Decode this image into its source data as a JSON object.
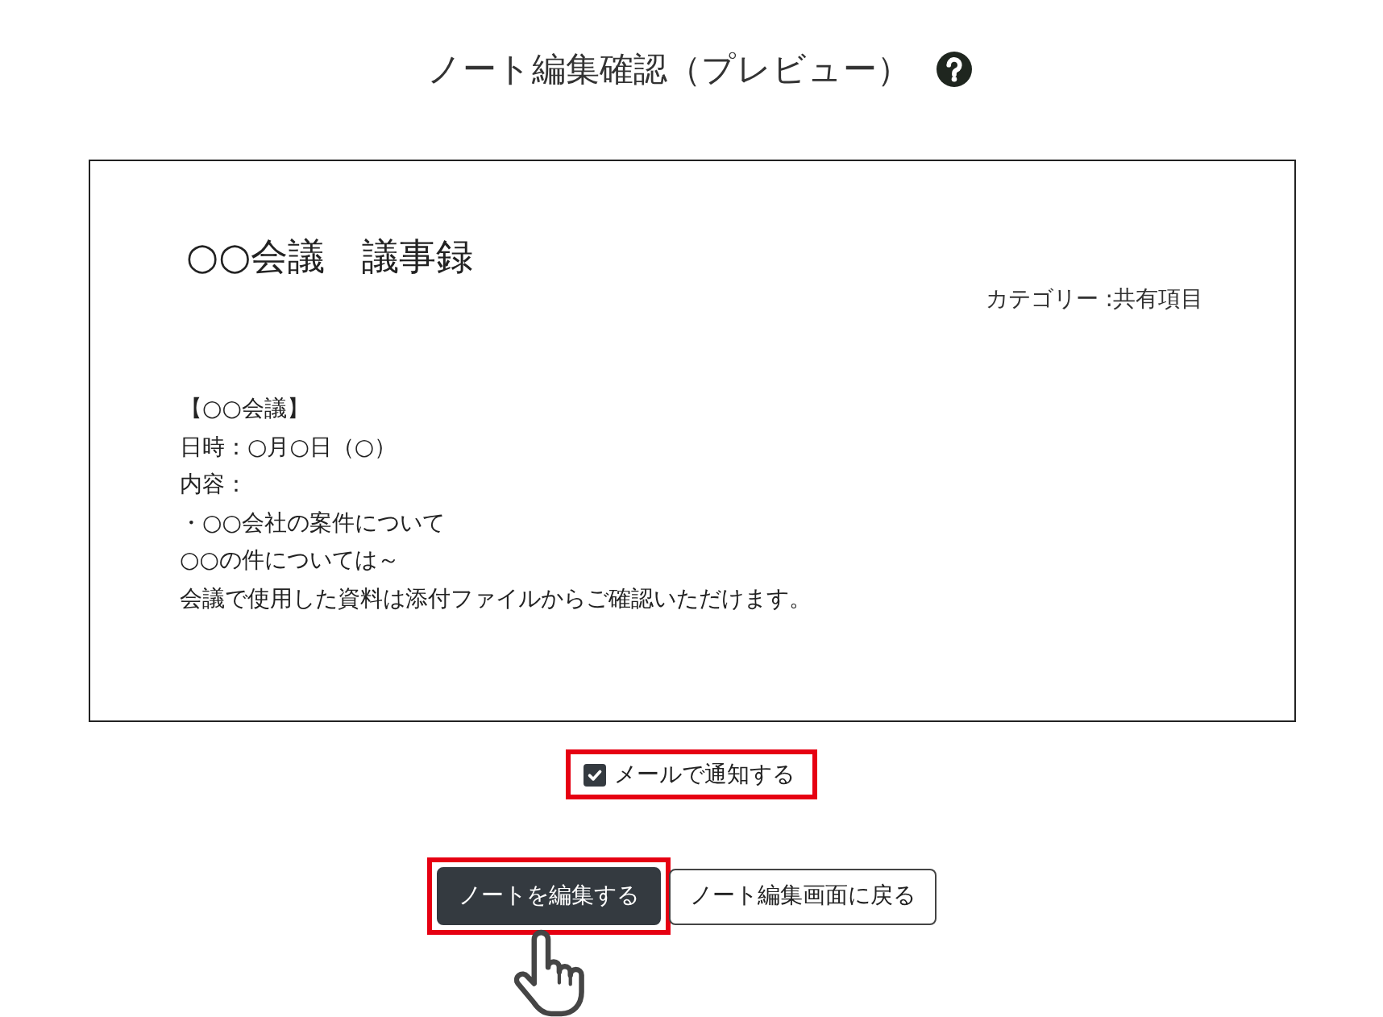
{
  "page": {
    "title": "ノート編集確認（プレビュー）"
  },
  "note": {
    "title": "○○会議　議事録",
    "category": "カテゴリー :共有項目",
    "body": [
      "【○○会議】",
      "日時：○月○日（○）",
      "内容：",
      "・○○会社の案件について",
      "○○の件については～",
      "会議で使用した資料は添付ファイルからご確認いただけます。"
    ]
  },
  "notify": {
    "label": "メールで通知する",
    "checked": true,
    "highlighted": true
  },
  "buttons": [
    {
      "label": "ノートを編集する",
      "kind": "primary",
      "highlighted": true
    },
    {
      "label": "ノート編集画面に戻る",
      "kind": "secondary",
      "highlighted": false
    }
  ]
}
